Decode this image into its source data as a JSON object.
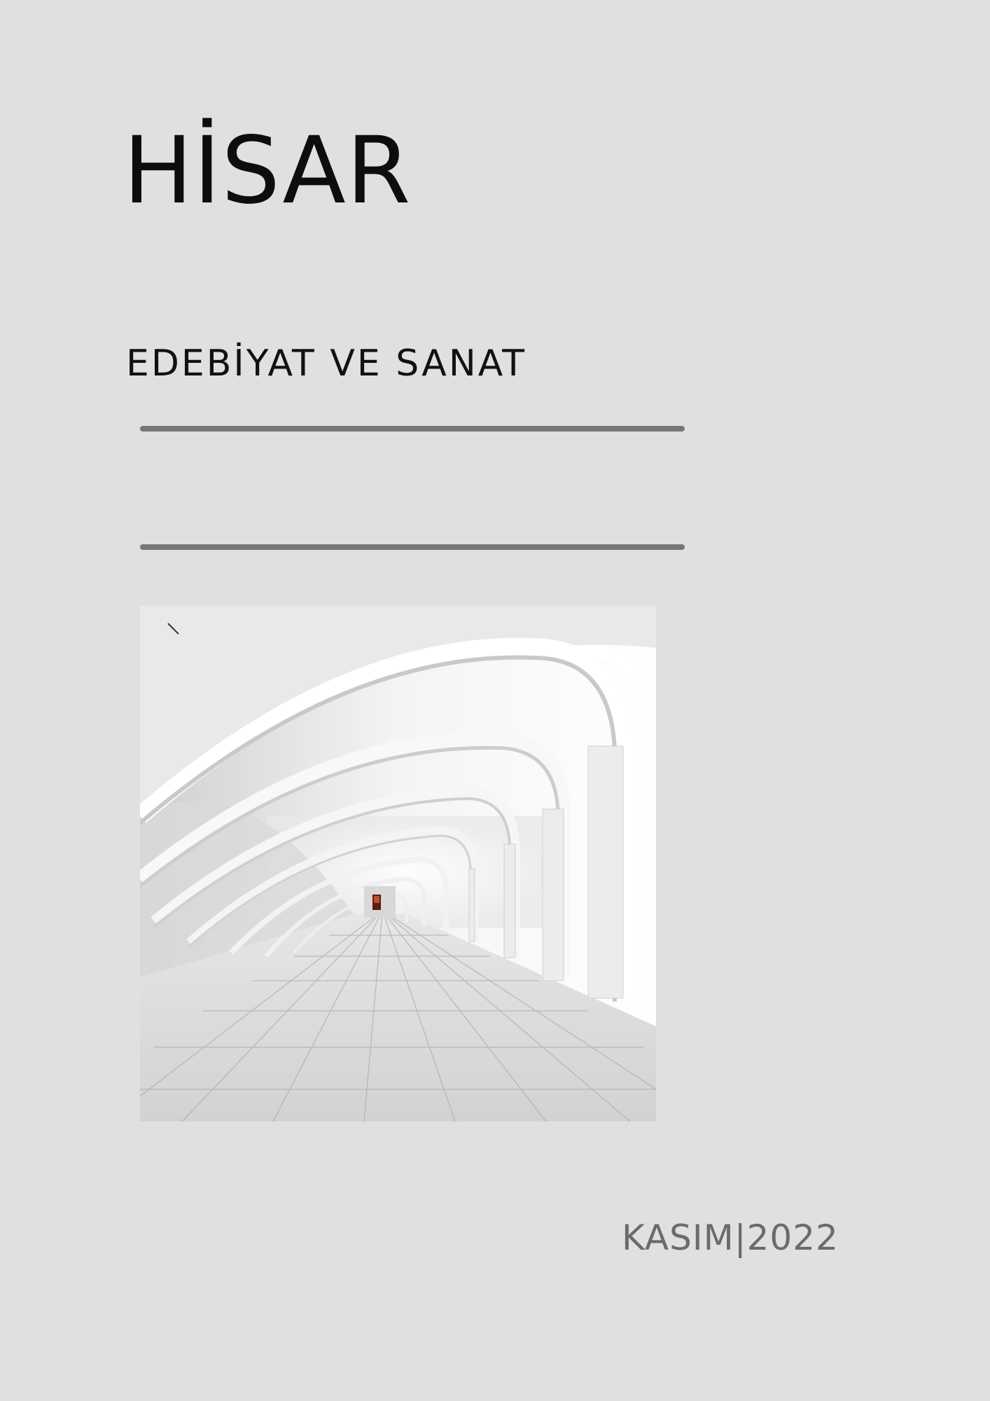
{
  "cover": {
    "title": "HİSAR",
    "subtitle": "EDEBİYAT VE SANAT",
    "date": "KASIM|2022"
  },
  "colors": {
    "background": "#e0e0e0",
    "title": "#0d0d0d",
    "rule": "#767676",
    "date": "#6b6b6b"
  },
  "image": {
    "subject": "white arched corridor with tiled floor"
  }
}
